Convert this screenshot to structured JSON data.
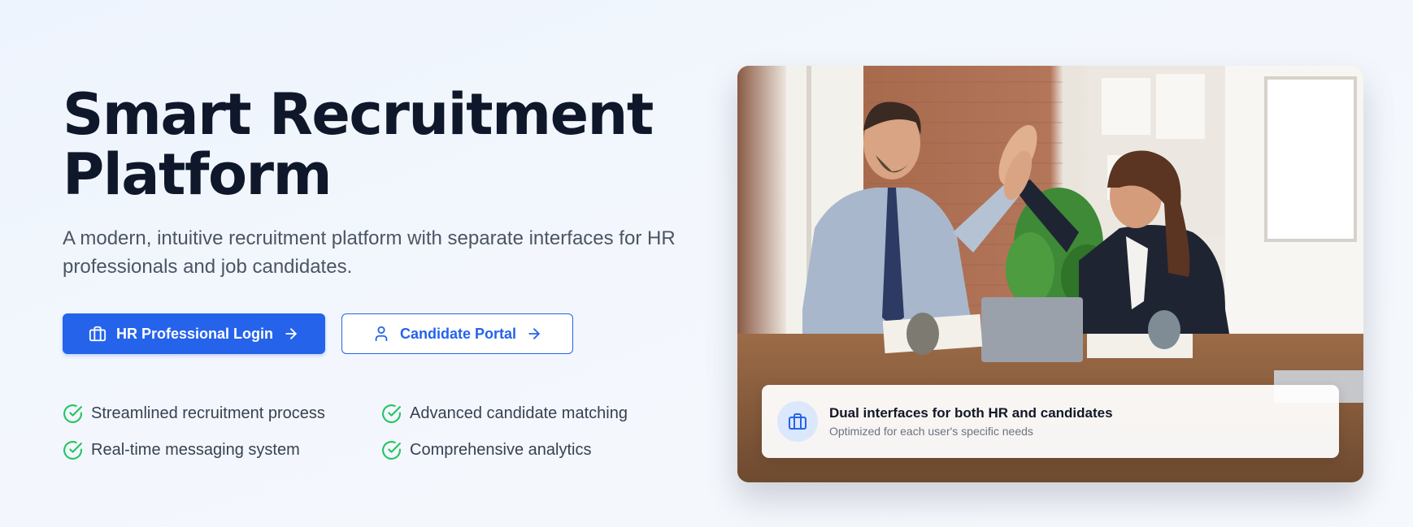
{
  "hero": {
    "title_line1": "Smart Recruitment",
    "title_line2": "Platform",
    "subtitle": "A modern, intuitive recruitment platform with separate interfaces for HR professionals and job candidates."
  },
  "buttons": {
    "hr_login": {
      "label": "HR Professional Login",
      "icon": "briefcase-icon",
      "trail_icon": "arrow-right-icon"
    },
    "candidate_portal": {
      "label": "Candidate Portal",
      "icon": "user-icon",
      "trail_icon": "arrow-right-icon"
    }
  },
  "features": [
    "Streamlined recruitment process",
    "Advanced candidate matching",
    "Real-time messaging system",
    "Comprehensive analytics"
  ],
  "image_card": {
    "caption_title": "Dual interfaces for both HR and candidates",
    "caption_subtitle": "Optimized for each user's specific needs",
    "caption_icon": "briefcase-icon"
  },
  "colors": {
    "accent": "#2563eb",
    "check": "#22c55e",
    "heading": "#0f172a",
    "body_text": "#4b5563"
  }
}
